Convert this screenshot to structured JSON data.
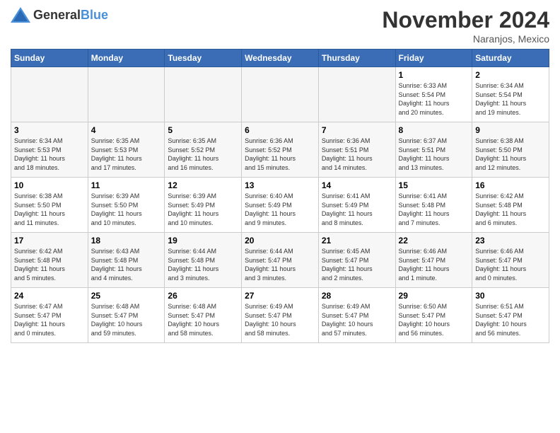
{
  "header": {
    "logo_general": "General",
    "logo_blue": "Blue",
    "month_title": "November 2024",
    "location": "Naranjos, Mexico"
  },
  "days_of_week": [
    "Sunday",
    "Monday",
    "Tuesday",
    "Wednesday",
    "Thursday",
    "Friday",
    "Saturday"
  ],
  "weeks": [
    {
      "row_class": "row-white",
      "days": [
        {
          "num": "",
          "info": "",
          "empty": true
        },
        {
          "num": "",
          "info": "",
          "empty": true
        },
        {
          "num": "",
          "info": "",
          "empty": true
        },
        {
          "num": "",
          "info": "",
          "empty": true
        },
        {
          "num": "",
          "info": "",
          "empty": true
        },
        {
          "num": "1",
          "info": "Sunrise: 6:33 AM\nSunset: 5:54 PM\nDaylight: 11 hours\nand 20 minutes.",
          "empty": false
        },
        {
          "num": "2",
          "info": "Sunrise: 6:34 AM\nSunset: 5:54 PM\nDaylight: 11 hours\nand 19 minutes.",
          "empty": false
        }
      ]
    },
    {
      "row_class": "row-gray",
      "days": [
        {
          "num": "3",
          "info": "Sunrise: 6:34 AM\nSunset: 5:53 PM\nDaylight: 11 hours\nand 18 minutes.",
          "empty": false
        },
        {
          "num": "4",
          "info": "Sunrise: 6:35 AM\nSunset: 5:53 PM\nDaylight: 11 hours\nand 17 minutes.",
          "empty": false
        },
        {
          "num": "5",
          "info": "Sunrise: 6:35 AM\nSunset: 5:52 PM\nDaylight: 11 hours\nand 16 minutes.",
          "empty": false
        },
        {
          "num": "6",
          "info": "Sunrise: 6:36 AM\nSunset: 5:52 PM\nDaylight: 11 hours\nand 15 minutes.",
          "empty": false
        },
        {
          "num": "7",
          "info": "Sunrise: 6:36 AM\nSunset: 5:51 PM\nDaylight: 11 hours\nand 14 minutes.",
          "empty": false
        },
        {
          "num": "8",
          "info": "Sunrise: 6:37 AM\nSunset: 5:51 PM\nDaylight: 11 hours\nand 13 minutes.",
          "empty": false
        },
        {
          "num": "9",
          "info": "Sunrise: 6:38 AM\nSunset: 5:50 PM\nDaylight: 11 hours\nand 12 minutes.",
          "empty": false
        }
      ]
    },
    {
      "row_class": "row-white",
      "days": [
        {
          "num": "10",
          "info": "Sunrise: 6:38 AM\nSunset: 5:50 PM\nDaylight: 11 hours\nand 11 minutes.",
          "empty": false
        },
        {
          "num": "11",
          "info": "Sunrise: 6:39 AM\nSunset: 5:50 PM\nDaylight: 11 hours\nand 10 minutes.",
          "empty": false
        },
        {
          "num": "12",
          "info": "Sunrise: 6:39 AM\nSunset: 5:49 PM\nDaylight: 11 hours\nand 10 minutes.",
          "empty": false
        },
        {
          "num": "13",
          "info": "Sunrise: 6:40 AM\nSunset: 5:49 PM\nDaylight: 11 hours\nand 9 minutes.",
          "empty": false
        },
        {
          "num": "14",
          "info": "Sunrise: 6:41 AM\nSunset: 5:49 PM\nDaylight: 11 hours\nand 8 minutes.",
          "empty": false
        },
        {
          "num": "15",
          "info": "Sunrise: 6:41 AM\nSunset: 5:48 PM\nDaylight: 11 hours\nand 7 minutes.",
          "empty": false
        },
        {
          "num": "16",
          "info": "Sunrise: 6:42 AM\nSunset: 5:48 PM\nDaylight: 11 hours\nand 6 minutes.",
          "empty": false
        }
      ]
    },
    {
      "row_class": "row-gray",
      "days": [
        {
          "num": "17",
          "info": "Sunrise: 6:42 AM\nSunset: 5:48 PM\nDaylight: 11 hours\nand 5 minutes.",
          "empty": false
        },
        {
          "num": "18",
          "info": "Sunrise: 6:43 AM\nSunset: 5:48 PM\nDaylight: 11 hours\nand 4 minutes.",
          "empty": false
        },
        {
          "num": "19",
          "info": "Sunrise: 6:44 AM\nSunset: 5:48 PM\nDaylight: 11 hours\nand 3 minutes.",
          "empty": false
        },
        {
          "num": "20",
          "info": "Sunrise: 6:44 AM\nSunset: 5:47 PM\nDaylight: 11 hours\nand 3 minutes.",
          "empty": false
        },
        {
          "num": "21",
          "info": "Sunrise: 6:45 AM\nSunset: 5:47 PM\nDaylight: 11 hours\nand 2 minutes.",
          "empty": false
        },
        {
          "num": "22",
          "info": "Sunrise: 6:46 AM\nSunset: 5:47 PM\nDaylight: 11 hours\nand 1 minute.",
          "empty": false
        },
        {
          "num": "23",
          "info": "Sunrise: 6:46 AM\nSunset: 5:47 PM\nDaylight: 11 hours\nand 0 minutes.",
          "empty": false
        }
      ]
    },
    {
      "row_class": "row-white",
      "days": [
        {
          "num": "24",
          "info": "Sunrise: 6:47 AM\nSunset: 5:47 PM\nDaylight: 11 hours\nand 0 minutes.",
          "empty": false
        },
        {
          "num": "25",
          "info": "Sunrise: 6:48 AM\nSunset: 5:47 PM\nDaylight: 10 hours\nand 59 minutes.",
          "empty": false
        },
        {
          "num": "26",
          "info": "Sunrise: 6:48 AM\nSunset: 5:47 PM\nDaylight: 10 hours\nand 58 minutes.",
          "empty": false
        },
        {
          "num": "27",
          "info": "Sunrise: 6:49 AM\nSunset: 5:47 PM\nDaylight: 10 hours\nand 58 minutes.",
          "empty": false
        },
        {
          "num": "28",
          "info": "Sunrise: 6:49 AM\nSunset: 5:47 PM\nDaylight: 10 hours\nand 57 minutes.",
          "empty": false
        },
        {
          "num": "29",
          "info": "Sunrise: 6:50 AM\nSunset: 5:47 PM\nDaylight: 10 hours\nand 56 minutes.",
          "empty": false
        },
        {
          "num": "30",
          "info": "Sunrise: 6:51 AM\nSunset: 5:47 PM\nDaylight: 10 hours\nand 56 minutes.",
          "empty": false
        }
      ]
    }
  ]
}
